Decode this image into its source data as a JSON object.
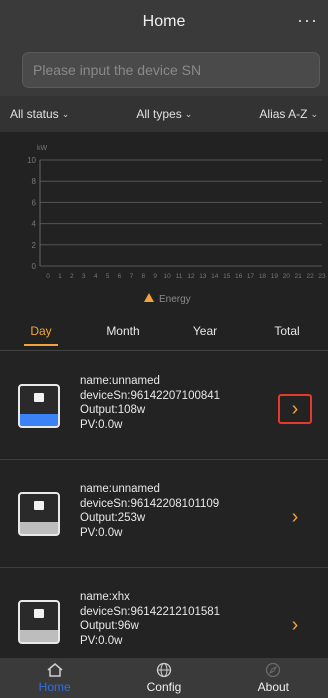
{
  "header": {
    "title": "Home",
    "more_label": "···"
  },
  "search": {
    "placeholder": "Please input the device SN"
  },
  "filters": [
    {
      "label": "All status"
    },
    {
      "label": "All types"
    },
    {
      "label": "Alias A-Z"
    }
  ],
  "chart_data": {
    "type": "line",
    "ylabel": "kW",
    "ylim": [
      0,
      10
    ],
    "yticks": [
      "0",
      "2",
      "4",
      "6",
      "8",
      "10"
    ],
    "x": [
      "0",
      "1",
      "2",
      "3",
      "4",
      "5",
      "6",
      "7",
      "8",
      "9",
      "10",
      "11",
      "12",
      "13",
      "14",
      "15",
      "16",
      "17",
      "18",
      "19",
      "20",
      "21",
      "22",
      "23"
    ],
    "series": [
      {
        "name": "Energy",
        "values": []
      }
    ],
    "legend": "bottom-center",
    "grid": true
  },
  "tabs": [
    {
      "label": "Day"
    },
    {
      "label": "Month"
    },
    {
      "label": "Year"
    },
    {
      "label": "Total"
    }
  ],
  "devices": [
    {
      "name": "name:unnamed",
      "sn": "deviceSn:96142207100841",
      "output": "Output:108w",
      "pv": "PV:0.0w",
      "color": "#3b82f6"
    },
    {
      "name": "name:unnamed",
      "sn": "deviceSn:96142208101109",
      "output": "Output:253w",
      "pv": "PV:0.0w",
      "color": "#bdbdbd"
    },
    {
      "name": "name:xhx",
      "sn": "deviceSn:96142212101581",
      "output": "Output:96w",
      "pv": "PV:0.0w",
      "color": "#bdbdbd"
    }
  ],
  "nav": [
    {
      "label": "Home",
      "icon": "home-icon"
    },
    {
      "label": "Config",
      "icon": "globe-icon"
    },
    {
      "label": "About",
      "icon": "compass-icon"
    }
  ],
  "colors": {
    "accent": "#f2a33a",
    "active_nav": "#2f6fe0",
    "selection": "#e53a2a"
  }
}
